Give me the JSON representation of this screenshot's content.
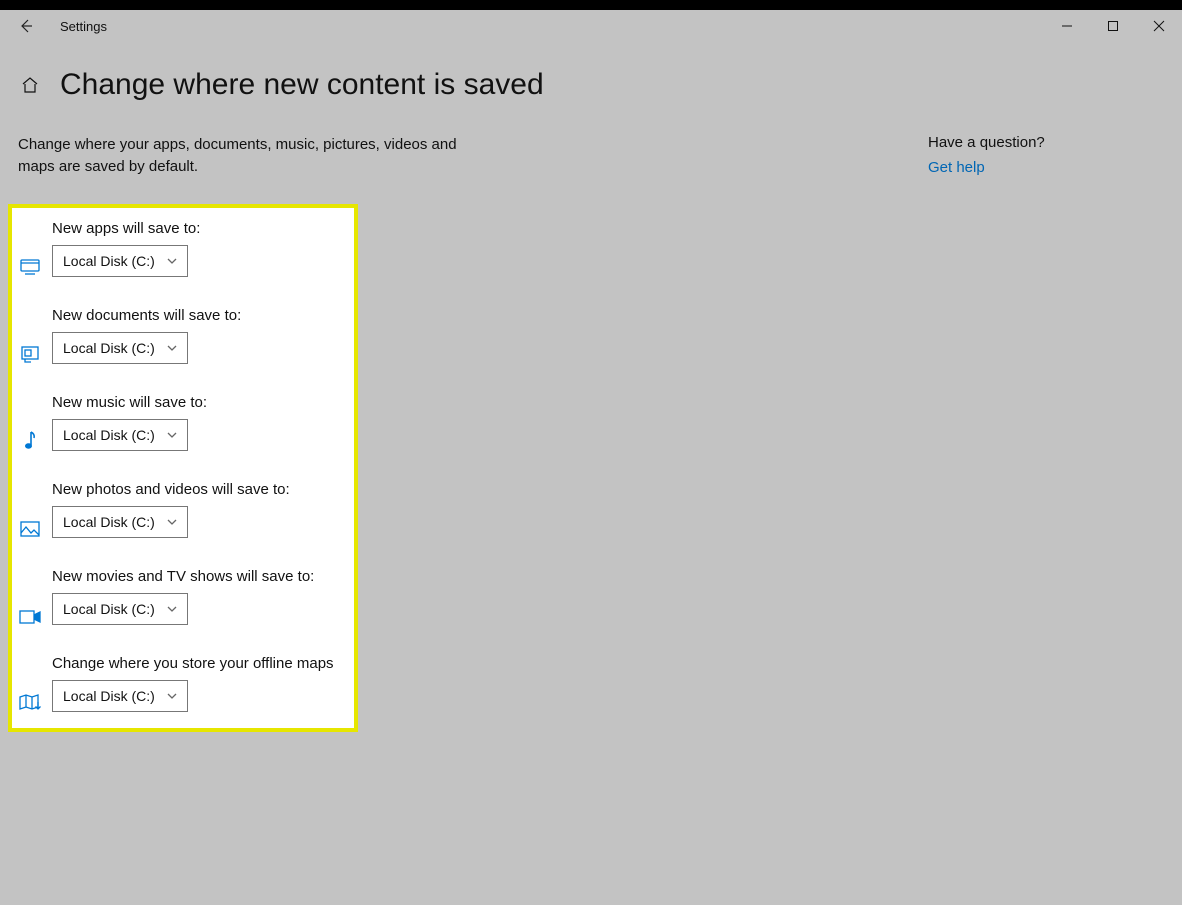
{
  "app_title": "Settings",
  "page_title": "Change where new content is saved",
  "description": "Change where your apps, documents, music, pictures, videos and maps are saved by default.",
  "settings": [
    {
      "label": "New apps will save to:",
      "value": "Local Disk (C:)"
    },
    {
      "label": "New documents will save to:",
      "value": "Local Disk (C:)"
    },
    {
      "label": "New music will save to:",
      "value": "Local Disk (C:)"
    },
    {
      "label": "New photos and videos will save to:",
      "value": "Local Disk (C:)"
    },
    {
      "label": "New movies and TV shows will save to:",
      "value": "Local Disk (C:)"
    },
    {
      "label": "Change where you store your offline maps",
      "value": "Local Disk (C:)"
    }
  ],
  "side": {
    "question": "Have a question?",
    "help": "Get help"
  }
}
